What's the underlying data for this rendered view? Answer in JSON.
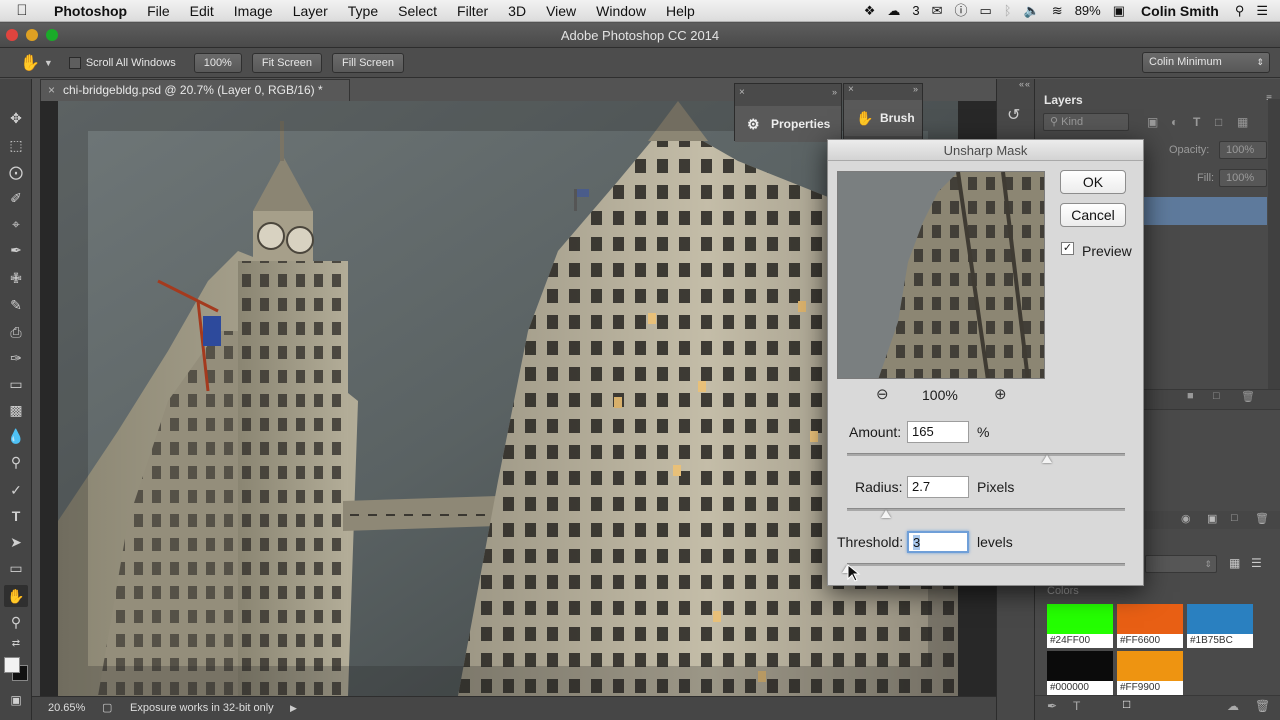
{
  "menubar": {
    "items": [
      "Photoshop",
      "File",
      "Edit",
      "Image",
      "Layer",
      "Type",
      "Select",
      "Filter",
      "3D",
      "View",
      "Window",
      "Help"
    ],
    "badge_count": "3",
    "battery": "89%",
    "user": "Colin Smith"
  },
  "window": {
    "title": "Adobe Photoshop CC 2014"
  },
  "options_bar": {
    "scroll_all": "Scroll All Windows",
    "zoom_btn": "100%",
    "fit_screen": "Fit Screen",
    "fill_screen": "Fill Screen",
    "workspace": "Colin Minimum"
  },
  "document": {
    "tab_title": "chi-bridgebldg.psd @ 20.7% (Layer 0, RGB/16) *",
    "zoom": "20.65%",
    "status": "Exposure works in 32-bit only"
  },
  "panels": {
    "properties": "Properties",
    "brush": "Brush",
    "layers": "Layers",
    "kind": "Kind",
    "opacity_label": "Opacity:",
    "opacity_value": "100%",
    "fill_label": "Fill:",
    "fill_value": "100%",
    "colors_title": "Colors",
    "swatches": [
      {
        "label": "#24FF00",
        "color": "#24FF00"
      },
      {
        "label": "#FF6600",
        "color": "#E85F14"
      },
      {
        "label": "#1B75BC",
        "color": "#2A80C0"
      },
      {
        "label": "#000000",
        "color": "#0b0b0b"
      },
      {
        "label": "#FF9900",
        "color": "#EE9411"
      }
    ]
  },
  "dialog": {
    "title": "Unsharp Mask",
    "ok": "OK",
    "cancel": "Cancel",
    "preview_label": "Preview",
    "preview_checked": true,
    "preview_zoom": "100%",
    "amount_label": "Amount:",
    "amount_value": "165",
    "amount_unit": "%",
    "radius_label": "Radius:",
    "radius_value": "2.7",
    "radius_unit": "Pixels",
    "threshold_label": "Threshold:",
    "threshold_value": "3",
    "threshold_unit": "levels"
  }
}
